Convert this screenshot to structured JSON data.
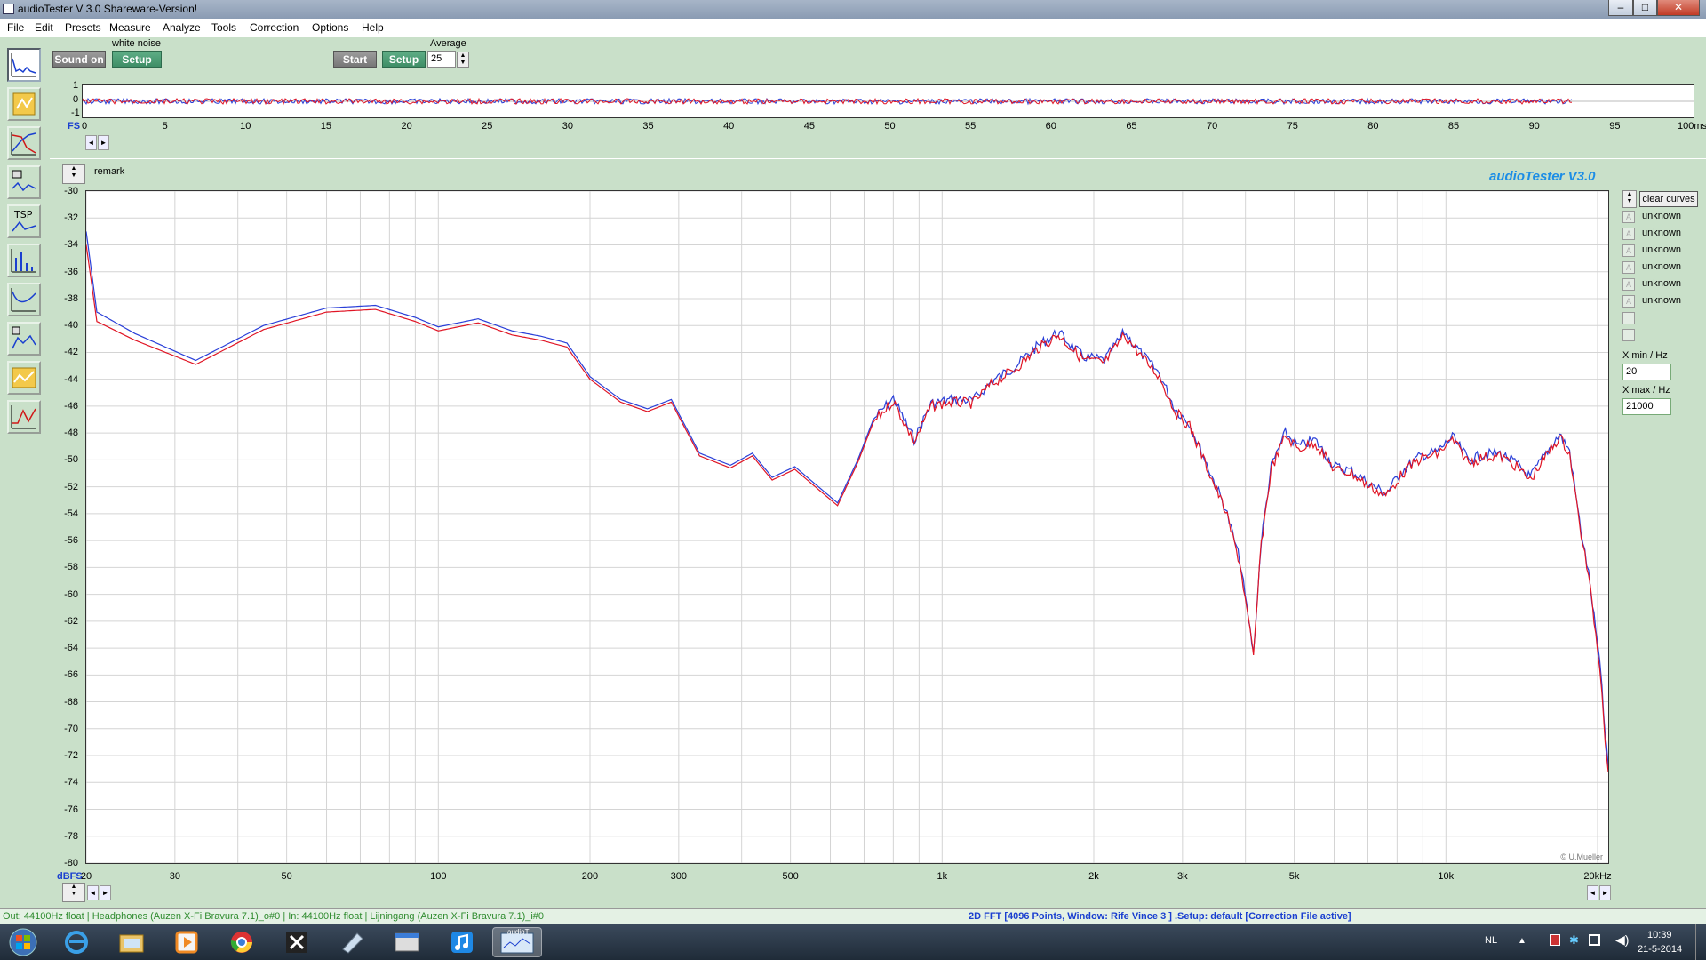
{
  "window": {
    "title": "audioTester  V 3.0 Shareware-Version!",
    "min": "–",
    "max": "□",
    "close": "✕"
  },
  "menu": [
    "File",
    "Edit",
    "Presets",
    "Measure",
    "Analyze",
    "Tools",
    "Correction",
    "Options",
    "Help"
  ],
  "toolbar": {
    "sound_on": "Sound on",
    "generator_label": "white noise",
    "setup1": "Setup",
    "start": "Start",
    "setup2": "Setup",
    "average_label": "Average",
    "average_value": "25"
  },
  "osc": {
    "y_ticks": [
      "1",
      "0",
      "-1"
    ],
    "x_ticks": [
      "0",
      "5",
      "10",
      "15",
      "20",
      "25",
      "30",
      "35",
      "40",
      "45",
      "50",
      "55",
      "60",
      "65",
      "70",
      "75",
      "80",
      "85",
      "90",
      "95"
    ],
    "x_unit_left": "FS",
    "x_unit_right": "100ms"
  },
  "plot": {
    "remark": "remark",
    "brand": "audioTester  V3.0",
    "copyright": "© U.Mueller",
    "y_unit": "dBFS",
    "clear_curves": "clear curves",
    "legend": [
      "unknown",
      "unknown",
      "unknown",
      "unknown",
      "unknown",
      "unknown",
      "",
      ""
    ],
    "xmin_label": "X min / Hz",
    "xmin_value": "20",
    "xmax_label": "X max / Hz",
    "xmax_value": "21000"
  },
  "chart_data": {
    "type": "line",
    "xscale": "log",
    "xlim": [
      20,
      21000
    ],
    "ylim": [
      -80,
      -30
    ],
    "x_tick_labels": [
      "20",
      "30",
      "50",
      "100",
      "200",
      "300",
      "500",
      "1k",
      "2k",
      "3k",
      "5k",
      "10k",
      "20kHz"
    ],
    "x_tick_values": [
      20,
      30,
      50,
      100,
      200,
      300,
      500,
      1000,
      2000,
      3000,
      5000,
      10000,
      20000
    ],
    "y_ticks": [
      -30,
      -32,
      -34,
      -36,
      -38,
      -40,
      -42,
      -44,
      -46,
      -48,
      -50,
      -52,
      -54,
      -56,
      -58,
      -60,
      -62,
      -64,
      -66,
      -68,
      -70,
      -72,
      -74,
      -76,
      -78,
      -80
    ],
    "grid": true,
    "series": [
      {
        "color": "#2a3fd8",
        "points": [
          [
            20,
            -33
          ],
          [
            21,
            -39
          ],
          [
            25,
            -40.6
          ],
          [
            33,
            -42.6
          ],
          [
            45,
            -40
          ],
          [
            60,
            -38.7
          ],
          [
            75,
            -38.5
          ],
          [
            90,
            -39.4
          ],
          [
            100,
            -40.1
          ],
          [
            120,
            -39.5
          ],
          [
            140,
            -40.4
          ],
          [
            160,
            -40.8
          ],
          [
            180,
            -41.3
          ],
          [
            200,
            -43.8
          ],
          [
            230,
            -45.5
          ],
          [
            260,
            -46.2
          ],
          [
            290,
            -45.5
          ],
          [
            330,
            -49.5
          ],
          [
            380,
            -50.4
          ],
          [
            420,
            -49.5
          ],
          [
            460,
            -51.3
          ],
          [
            510,
            -50.5
          ],
          [
            560,
            -51.8
          ],
          [
            620,
            -53.2
          ],
          [
            680,
            -50
          ],
          [
            730,
            -47
          ],
          [
            800,
            -45.4
          ],
          [
            880,
            -48.5
          ],
          [
            950,
            -45.8
          ],
          [
            1050,
            -45.5
          ],
          [
            1150,
            -45.6
          ],
          [
            1250,
            -44.2
          ],
          [
            1400,
            -43
          ],
          [
            1550,
            -41.5
          ],
          [
            1700,
            -40.5
          ],
          [
            1900,
            -42.3
          ],
          [
            2100,
            -42.6
          ],
          [
            2300,
            -40.5
          ],
          [
            2500,
            -42.2
          ],
          [
            2700,
            -43.6
          ],
          [
            2900,
            -46.2
          ],
          [
            3100,
            -47.3
          ],
          [
            3350,
            -50.3
          ],
          [
            3650,
            -53.6
          ],
          [
            3900,
            -57.5
          ],
          [
            4150,
            -64.4
          ],
          [
            4300,
            -56
          ],
          [
            4500,
            -50.5
          ],
          [
            4800,
            -48
          ],
          [
            5100,
            -49
          ],
          [
            5500,
            -48.5
          ],
          [
            6000,
            -50.5
          ],
          [
            6500,
            -50.8
          ],
          [
            7000,
            -51.7
          ],
          [
            7600,
            -52.5
          ],
          [
            8200,
            -50.8
          ],
          [
            8900,
            -49.7
          ],
          [
            9600,
            -49.4
          ],
          [
            10300,
            -48.3
          ],
          [
            11100,
            -50
          ],
          [
            11900,
            -49.6
          ],
          [
            12800,
            -49.5
          ],
          [
            13700,
            -50.2
          ],
          [
            14700,
            -51.3
          ],
          [
            15800,
            -49.5
          ],
          [
            16800,
            -48.1
          ],
          [
            17600,
            -49.3
          ],
          [
            18400,
            -54.5
          ],
          [
            19200,
            -58.5
          ],
          [
            20000,
            -63.8
          ],
          [
            20400,
            -66.8
          ],
          [
            20700,
            -70.5
          ],
          [
            21000,
            -72.8
          ]
        ]
      },
      {
        "color": "#e01525",
        "points": [
          [
            20,
            -34
          ],
          [
            21,
            -39.7
          ],
          [
            25,
            -41.1
          ],
          [
            33,
            -42.9
          ],
          [
            45,
            -40.3
          ],
          [
            60,
            -39
          ],
          [
            75,
            -38.8
          ],
          [
            90,
            -39.7
          ],
          [
            100,
            -40.4
          ],
          [
            120,
            -39.8
          ],
          [
            140,
            -40.7
          ],
          [
            160,
            -41.1
          ],
          [
            180,
            -41.6
          ],
          [
            200,
            -44
          ],
          [
            230,
            -45.7
          ],
          [
            260,
            -46.4
          ],
          [
            290,
            -45.7
          ],
          [
            330,
            -49.7
          ],
          [
            380,
            -50.6
          ],
          [
            420,
            -49.7
          ],
          [
            460,
            -51.5
          ],
          [
            510,
            -50.7
          ],
          [
            560,
            -52
          ],
          [
            620,
            -53.4
          ],
          [
            680,
            -50.2
          ],
          [
            730,
            -47.2
          ],
          [
            800,
            -45.6
          ],
          [
            880,
            -48.7
          ],
          [
            950,
            -46
          ],
          [
            1050,
            -45.7
          ],
          [
            1150,
            -45.8
          ],
          [
            1250,
            -44.4
          ],
          [
            1400,
            -43.2
          ],
          [
            1550,
            -41.7
          ],
          [
            1700,
            -40.7
          ],
          [
            1900,
            -42.5
          ],
          [
            2100,
            -42.8
          ],
          [
            2300,
            -40.7
          ],
          [
            2500,
            -42.4
          ],
          [
            2700,
            -43.8
          ],
          [
            2900,
            -46.4
          ],
          [
            3100,
            -47.5
          ],
          [
            3350,
            -50.5
          ],
          [
            3650,
            -53.8
          ],
          [
            3900,
            -57.7
          ],
          [
            4150,
            -64.6
          ],
          [
            4300,
            -56.2
          ],
          [
            4500,
            -50.7
          ],
          [
            4800,
            -48.2
          ],
          [
            5100,
            -49.2
          ],
          [
            5500,
            -48.7
          ],
          [
            6000,
            -50.7
          ],
          [
            6500,
            -51
          ],
          [
            7000,
            -51.9
          ],
          [
            7600,
            -52.7
          ],
          [
            8200,
            -51
          ],
          [
            8900,
            -49.9
          ],
          [
            9600,
            -49.6
          ],
          [
            10300,
            -48.5
          ],
          [
            11100,
            -50.2
          ],
          [
            11900,
            -49.8
          ],
          [
            12800,
            -49.7
          ],
          [
            13700,
            -50.4
          ],
          [
            14700,
            -51.5
          ],
          [
            15800,
            -49.7
          ],
          [
            16800,
            -48.3
          ],
          [
            17600,
            -49.5
          ],
          [
            18400,
            -54.7
          ],
          [
            19200,
            -58.7
          ],
          [
            20000,
            -64
          ],
          [
            20400,
            -67
          ],
          [
            20700,
            -70.7
          ],
          [
            21000,
            -73
          ]
        ]
      }
    ]
  },
  "status": {
    "left": "Out: 44100Hz float  | Headphones (Auzen X-Fi Bravura 7.1)_o#0  | In: 44100Hz float  | Lijningang (Auzen X-Fi Bravura 7.1)_i#0",
    "center": "2D FFT [4096 Points, Window: Rife Vince 3 ]  .Setup:  default  [Correction File active]"
  },
  "taskbar": {
    "lang": "NL",
    "time": "10:39",
    "date": "21-5-2014",
    "active_app": "audioT"
  }
}
